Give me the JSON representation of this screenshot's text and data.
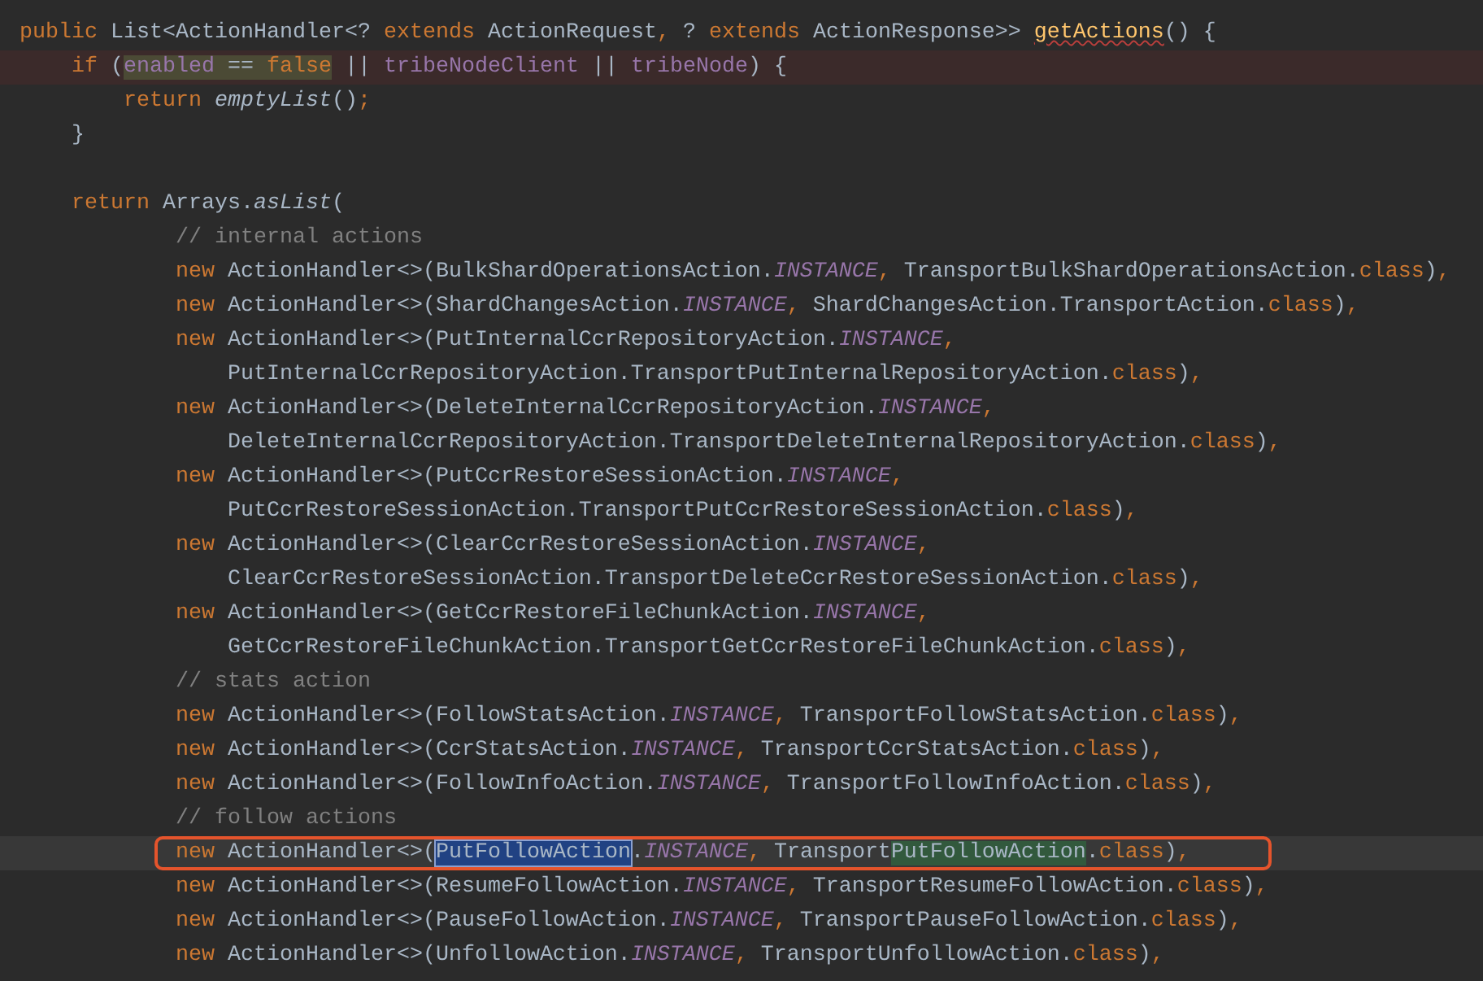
{
  "editor": {
    "lines": [
      {
        "highlighted": false,
        "current": false,
        "boxed": false,
        "tokens": [
          {
            "kind": "keyword",
            "text": "public"
          },
          {
            "kind": "plain",
            "text": " List<ActionHandler<? "
          },
          {
            "kind": "keyword",
            "text": "extends"
          },
          {
            "kind": "plain",
            "text": " ActionRequest"
          },
          {
            "kind": "keyword",
            "text": ","
          },
          {
            "kind": "plain",
            "text": " ? "
          },
          {
            "kind": "keyword",
            "text": "extends"
          },
          {
            "kind": "plain",
            "text": " ActionResponse>> "
          },
          {
            "kind": "method",
            "text": "getActions",
            "misspelled": true
          },
          {
            "kind": "plain",
            "text": "() {"
          }
        ]
      },
      {
        "highlighted": true,
        "current": false,
        "boxed": false,
        "tokens": [
          {
            "kind": "keyword",
            "text": "    if"
          },
          {
            "kind": "plain",
            "text": " ("
          },
          {
            "kind": "field",
            "text": "enabled",
            "usage_highlight": true
          },
          {
            "kind": "plain",
            "text": " == ",
            "usage_highlight": true
          },
          {
            "kind": "keyword",
            "text": "false",
            "usage_highlight": true
          },
          {
            "kind": "plain",
            "text": " || "
          },
          {
            "kind": "field",
            "text": "tribeNodeClient"
          },
          {
            "kind": "plain",
            "text": " || "
          },
          {
            "kind": "field",
            "text": "tribeNode"
          },
          {
            "kind": "plain",
            "text": ") {"
          }
        ]
      },
      {
        "highlighted": false,
        "current": false,
        "boxed": false,
        "tokens": [
          {
            "kind": "keyword",
            "text": "        return "
          },
          {
            "kind": "call",
            "text": "emptyList"
          },
          {
            "kind": "plain",
            "text": "()"
          },
          {
            "kind": "keyword",
            "text": ";"
          }
        ]
      },
      {
        "highlighted": false,
        "current": false,
        "boxed": false,
        "tokens": [
          {
            "kind": "plain",
            "text": "    }"
          }
        ]
      },
      {
        "highlighted": false,
        "current": false,
        "boxed": false
      },
      {
        "highlighted": false,
        "current": false,
        "boxed": false,
        "tokens": [
          {
            "kind": "keyword",
            "text": "    return"
          },
          {
            "kind": "plain",
            "text": " Arrays."
          },
          {
            "kind": "call",
            "text": "asList"
          },
          {
            "kind": "plain",
            "text": "("
          }
        ]
      },
      {
        "highlighted": false,
        "current": false,
        "boxed": false,
        "tokens": [
          {
            "kind": "comment",
            "text": "            // internal actions"
          }
        ]
      },
      {
        "highlighted": false,
        "current": false,
        "boxed": false,
        "tokens": [
          {
            "kind": "keyword",
            "text": "            new"
          },
          {
            "kind": "plain",
            "text": " ActionHandler<>(BulkShardOperationsAction."
          },
          {
            "kind": "static",
            "text": "INSTANCE"
          },
          {
            "kind": "keyword",
            "text": ","
          },
          {
            "kind": "plain",
            "text": " TransportBulkShardOperationsAction."
          },
          {
            "kind": "keyword",
            "text": "class"
          },
          {
            "kind": "plain",
            "text": ")"
          },
          {
            "kind": "keyword",
            "text": ","
          }
        ]
      },
      {
        "highlighted": false,
        "current": false,
        "boxed": false,
        "tokens": [
          {
            "kind": "keyword",
            "text": "            new"
          },
          {
            "kind": "plain",
            "text": " ActionHandler<>(ShardChangesAction."
          },
          {
            "kind": "static",
            "text": "INSTANCE"
          },
          {
            "kind": "keyword",
            "text": ","
          },
          {
            "kind": "plain",
            "text": " ShardChangesAction.TransportAction."
          },
          {
            "kind": "keyword",
            "text": "class"
          },
          {
            "kind": "plain",
            "text": ")"
          },
          {
            "kind": "keyword",
            "text": ","
          }
        ]
      },
      {
        "highlighted": false,
        "current": false,
        "boxed": false,
        "tokens": [
          {
            "kind": "keyword",
            "text": "            new"
          },
          {
            "kind": "plain",
            "text": " ActionHandler<>(PutInternalCcrRepositoryAction."
          },
          {
            "kind": "static",
            "text": "INSTANCE"
          },
          {
            "kind": "keyword",
            "text": ","
          }
        ]
      },
      {
        "highlighted": false,
        "current": false,
        "boxed": false,
        "tokens": [
          {
            "kind": "plain",
            "text": "                PutInternalCcrRepositoryAction.TransportPutInternalRepositoryAction."
          },
          {
            "kind": "keyword",
            "text": "class"
          },
          {
            "kind": "plain",
            "text": ")"
          },
          {
            "kind": "keyword",
            "text": ","
          }
        ]
      },
      {
        "highlighted": false,
        "current": false,
        "boxed": false,
        "tokens": [
          {
            "kind": "keyword",
            "text": "            new"
          },
          {
            "kind": "plain",
            "text": " ActionHandler<>(DeleteInternalCcrRepositoryAction."
          },
          {
            "kind": "static",
            "text": "INSTANCE"
          },
          {
            "kind": "keyword",
            "text": ","
          }
        ]
      },
      {
        "highlighted": false,
        "current": false,
        "boxed": false,
        "tokens": [
          {
            "kind": "plain",
            "text": "                DeleteInternalCcrRepositoryAction.TransportDeleteInternalRepositoryAction."
          },
          {
            "kind": "keyword",
            "text": "class"
          },
          {
            "kind": "plain",
            "text": ")"
          },
          {
            "kind": "keyword",
            "text": ","
          }
        ]
      },
      {
        "highlighted": false,
        "current": false,
        "boxed": false,
        "tokens": [
          {
            "kind": "keyword",
            "text": "            new"
          },
          {
            "kind": "plain",
            "text": " ActionHandler<>(PutCcrRestoreSessionAction."
          },
          {
            "kind": "static",
            "text": "INSTANCE"
          },
          {
            "kind": "keyword",
            "text": ","
          }
        ]
      },
      {
        "highlighted": false,
        "current": false,
        "boxed": false,
        "tokens": [
          {
            "kind": "plain",
            "text": "                PutCcrRestoreSessionAction.TransportPutCcrRestoreSessionAction."
          },
          {
            "kind": "keyword",
            "text": "class"
          },
          {
            "kind": "plain",
            "text": ")"
          },
          {
            "kind": "keyword",
            "text": ","
          }
        ]
      },
      {
        "highlighted": false,
        "current": false,
        "boxed": false,
        "tokens": [
          {
            "kind": "keyword",
            "text": "            new"
          },
          {
            "kind": "plain",
            "text": " ActionHandler<>(ClearCcrRestoreSessionAction."
          },
          {
            "kind": "static",
            "text": "INSTANCE"
          },
          {
            "kind": "keyword",
            "text": ","
          }
        ]
      },
      {
        "highlighted": false,
        "current": false,
        "boxed": false,
        "tokens": [
          {
            "kind": "plain",
            "text": "                ClearCcrRestoreSessionAction.TransportDeleteCcrRestoreSessionAction."
          },
          {
            "kind": "keyword",
            "text": "class"
          },
          {
            "kind": "plain",
            "text": ")"
          },
          {
            "kind": "keyword",
            "text": ","
          }
        ]
      },
      {
        "highlighted": false,
        "current": false,
        "boxed": false,
        "tokens": [
          {
            "kind": "keyword",
            "text": "            new"
          },
          {
            "kind": "plain",
            "text": " ActionHandler<>(GetCcrRestoreFileChunkAction."
          },
          {
            "kind": "static",
            "text": "INSTANCE"
          },
          {
            "kind": "keyword",
            "text": ","
          }
        ]
      },
      {
        "highlighted": false,
        "current": false,
        "boxed": false,
        "tokens": [
          {
            "kind": "plain",
            "text": "                GetCcrRestoreFileChunkAction.TransportGetCcrRestoreFileChunkAction."
          },
          {
            "kind": "keyword",
            "text": "class"
          },
          {
            "kind": "plain",
            "text": ")"
          },
          {
            "kind": "keyword",
            "text": ","
          }
        ]
      },
      {
        "highlighted": false,
        "current": false,
        "boxed": false,
        "tokens": [
          {
            "kind": "comment",
            "text": "            // stats action"
          }
        ]
      },
      {
        "highlighted": false,
        "current": false,
        "boxed": false,
        "tokens": [
          {
            "kind": "keyword",
            "text": "            new"
          },
          {
            "kind": "plain",
            "text": " ActionHandler<>(FollowStatsAction."
          },
          {
            "kind": "static",
            "text": "INSTANCE"
          },
          {
            "kind": "keyword",
            "text": ","
          },
          {
            "kind": "plain",
            "text": " TransportFollowStatsAction."
          },
          {
            "kind": "keyword",
            "text": "class"
          },
          {
            "kind": "plain",
            "text": ")"
          },
          {
            "kind": "keyword",
            "text": ","
          }
        ]
      },
      {
        "highlighted": false,
        "current": false,
        "boxed": false,
        "tokens": [
          {
            "kind": "keyword",
            "text": "            new"
          },
          {
            "kind": "plain",
            "text": " ActionHandler<>(CcrStatsAction."
          },
          {
            "kind": "static",
            "text": "INSTANCE"
          },
          {
            "kind": "keyword",
            "text": ","
          },
          {
            "kind": "plain",
            "text": " TransportCcrStatsAction."
          },
          {
            "kind": "keyword",
            "text": "class"
          },
          {
            "kind": "plain",
            "text": ")"
          },
          {
            "kind": "keyword",
            "text": ","
          }
        ]
      },
      {
        "highlighted": false,
        "current": false,
        "boxed": false,
        "tokens": [
          {
            "kind": "keyword",
            "text": "            new"
          },
          {
            "kind": "plain",
            "text": " ActionHandler<>(FollowInfoAction."
          },
          {
            "kind": "static",
            "text": "INSTANCE"
          },
          {
            "kind": "keyword",
            "text": ","
          },
          {
            "kind": "plain",
            "text": " TransportFollowInfoAction."
          },
          {
            "kind": "keyword",
            "text": "class"
          },
          {
            "kind": "plain",
            "text": ")"
          },
          {
            "kind": "keyword",
            "text": ","
          }
        ]
      },
      {
        "highlighted": false,
        "current": false,
        "boxed": false,
        "tokens": [
          {
            "kind": "comment",
            "text": "            // follow actions"
          }
        ]
      },
      {
        "highlighted": false,
        "current": true,
        "boxed": true,
        "tokens": [
          {
            "kind": "keyword",
            "text": "            new"
          },
          {
            "kind": "plain",
            "text": " ActionHandler<>("
          },
          {
            "kind": "plain",
            "text": "PutFollowAction",
            "selected": true
          },
          {
            "kind": "plain",
            "text": "."
          },
          {
            "kind": "static",
            "text": "INSTANCE"
          },
          {
            "kind": "keyword",
            "text": ","
          },
          {
            "kind": "plain",
            "text": " Transport"
          },
          {
            "kind": "plain",
            "text": "PutFollowAction",
            "search_match": true
          },
          {
            "kind": "plain",
            "text": "."
          },
          {
            "kind": "keyword",
            "text": "class"
          },
          {
            "kind": "plain",
            "text": ")"
          },
          {
            "kind": "keyword",
            "text": ","
          }
        ]
      },
      {
        "highlighted": false,
        "current": false,
        "boxed": false,
        "tokens": [
          {
            "kind": "keyword",
            "text": "            new"
          },
          {
            "kind": "plain",
            "text": " ActionHandler<>(ResumeFollowAction."
          },
          {
            "kind": "static",
            "text": "INSTANCE"
          },
          {
            "kind": "keyword",
            "text": ","
          },
          {
            "kind": "plain",
            "text": " TransportResumeFollowAction."
          },
          {
            "kind": "keyword",
            "text": "class"
          },
          {
            "kind": "plain",
            "text": ")"
          },
          {
            "kind": "keyword",
            "text": ","
          }
        ]
      },
      {
        "highlighted": false,
        "current": false,
        "boxed": false,
        "tokens": [
          {
            "kind": "keyword",
            "text": "            new"
          },
          {
            "kind": "plain",
            "text": " ActionHandler<>(PauseFollowAction."
          },
          {
            "kind": "static",
            "text": "INSTANCE"
          },
          {
            "kind": "keyword",
            "text": ","
          },
          {
            "kind": "plain",
            "text": " TransportPauseFollowAction."
          },
          {
            "kind": "keyword",
            "text": "class"
          },
          {
            "kind": "plain",
            "text": ")"
          },
          {
            "kind": "keyword",
            "text": ","
          }
        ]
      },
      {
        "highlighted": false,
        "current": false,
        "boxed": false,
        "tokens": [
          {
            "kind": "keyword",
            "text": "            new"
          },
          {
            "kind": "plain",
            "text": " ActionHandler<>(UnfollowAction."
          },
          {
            "kind": "static",
            "text": "INSTANCE"
          },
          {
            "kind": "keyword",
            "text": ","
          },
          {
            "kind": "plain",
            "text": " TransportUnfollowAction."
          },
          {
            "kind": "keyword",
            "text": "class"
          },
          {
            "kind": "plain",
            "text": ")"
          },
          {
            "kind": "keyword",
            "text": ","
          }
        ]
      }
    ]
  }
}
